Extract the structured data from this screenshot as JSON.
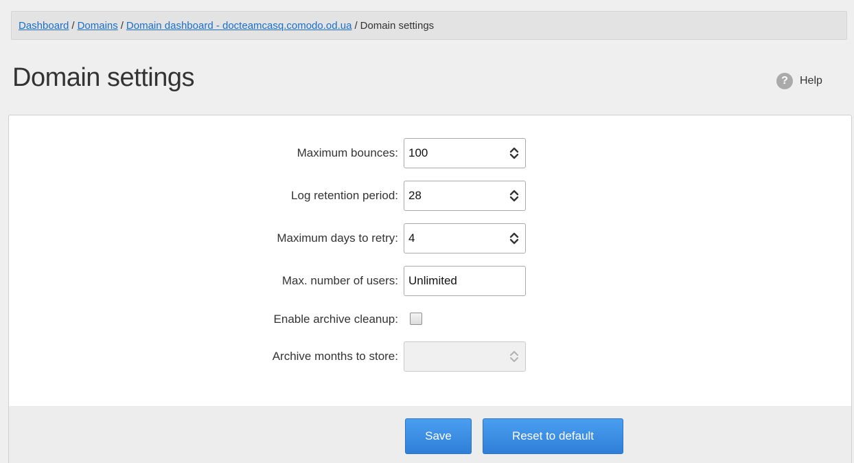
{
  "breadcrumb": {
    "items": [
      {
        "label": "Dashboard"
      },
      {
        "label": "Domains"
      },
      {
        "label": "Domain dashboard - docteamcasq.comodo.od.ua"
      }
    ],
    "current": "Domain settings",
    "separator": "/"
  },
  "page": {
    "title": "Domain settings",
    "help_label": "Help",
    "help_icon": "question-circle-icon"
  },
  "form": {
    "max_bounces": {
      "label": "Maximum bounces:",
      "value": "100"
    },
    "log_retention": {
      "label": "Log retention period:",
      "value": "28"
    },
    "max_days_retry": {
      "label": "Maximum days to retry:",
      "value": "4"
    },
    "max_users": {
      "label": "Max. number of users:",
      "value": "Unlimited"
    },
    "archive_cleanup": {
      "label": "Enable archive cleanup:",
      "checked": false
    },
    "archive_months": {
      "label": "Archive months to store:",
      "value": "",
      "disabled": true
    }
  },
  "actions": {
    "save_label": "Save",
    "reset_label": "Reset to default"
  },
  "colors": {
    "link": "#1a6fc9",
    "button": "#3a8be4",
    "background": "#efefef"
  }
}
